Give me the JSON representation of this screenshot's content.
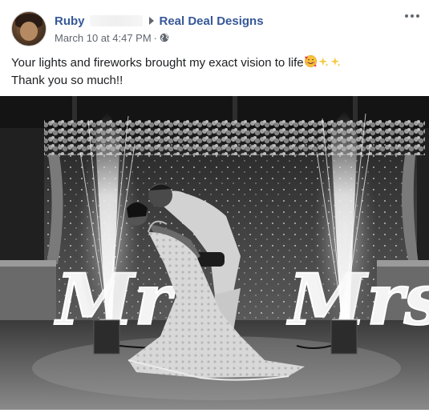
{
  "post": {
    "author": "Ruby",
    "page_name": "Real Deal Designs",
    "timestamp": "March 10 at 4:47 PM",
    "separator": "·",
    "privacy_icon": "globe-icon",
    "menu_icon": "more-options-icon",
    "text_line1": "Your lights and fireworks brought my exact vision to life",
    "text_line2": "Thank you so much!!",
    "emojis": [
      "smiling-face-with-hearts-icon",
      "sparkles-icon",
      "sparkles-icon"
    ]
  },
  "photo": {
    "sign_left": "Mr",
    "sign_right": "Mrs",
    "style": "black-and-white"
  },
  "colors": {
    "link": "#365899",
    "meta": "#606770",
    "text": "#1c1e21"
  }
}
